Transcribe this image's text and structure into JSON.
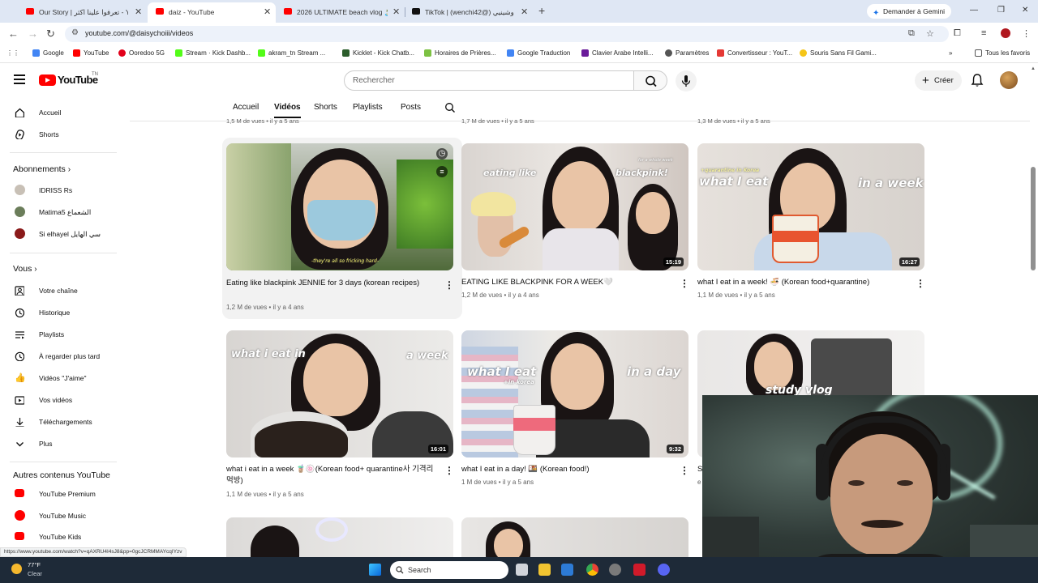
{
  "browser": {
    "tabs": [
      {
        "title": "Our Story | تعرفوا علينا اكثر - You",
        "active": false
      },
      {
        "title": "daiz - YouTube",
        "active": true
      },
      {
        "title": "2026 ULTIMATE beach vlog 🏝️ -",
        "active": false
      },
      {
        "title": "TikTok | (wenchi42@) وشينيي",
        "active": false
      }
    ],
    "gemini_button": "Demander à Gemini",
    "url": "youtube.com/@daisychoiii/videos",
    "bookmarks": [
      "Google",
      "YouTube",
      "Ooredoo 5G",
      "Stream · Kick Dashb...",
      "akram_tn Stream ...",
      "Kicklet - Kick Chatb...",
      "Horaires de Prières...",
      "Google Traduction",
      "Clavier Arabe Intelli...",
      "Paramètres",
      "Convertisseur : YouT...",
      "Souris Sans Fil Gami..."
    ],
    "all_favorites": "Tous les favoris",
    "colors": {
      "tabbar": "#dfe7f4",
      "youtube_red": "#ff0000"
    }
  },
  "masthead": {
    "logo_text": "YouTube",
    "country_code": "TN",
    "search_placeholder": "Rechercher",
    "create_label": "Créer"
  },
  "sidebar": {
    "top_items": [
      {
        "label": "Accueil",
        "icon": "home-icon"
      },
      {
        "label": "Shorts",
        "icon": "shorts-icon"
      }
    ],
    "subscriptions_title": "Abonnements",
    "subscriptions": [
      "IDRISS Rs",
      "Matima5 الشعماع",
      "Si elhayel سي الهايل"
    ],
    "you_title": "Vous",
    "you_items": [
      {
        "label": "Votre chaîne",
        "icon": "channel-icon"
      },
      {
        "label": "Historique",
        "icon": "history-icon"
      },
      {
        "label": "Playlists",
        "icon": "playlists-icon"
      },
      {
        "label": "À regarder plus tard",
        "icon": "watch-later-icon"
      },
      {
        "label": "Vidéos \"J'aime\"",
        "icon": "like-icon"
      },
      {
        "label": "Vos vidéos",
        "icon": "your-videos-icon"
      },
      {
        "label": "Téléchargements",
        "icon": "download-icon"
      },
      {
        "label": "Plus",
        "icon": "chevron-down-icon"
      }
    ],
    "more_title": "Autres contenus YouTube",
    "more_items": [
      "YouTube Premium",
      "YouTube Music",
      "YouTube Kids"
    ]
  },
  "channel_tabs": {
    "items": [
      "Accueil",
      "Vidéos",
      "Shorts",
      "Playlists",
      "Posts"
    ],
    "active": "Vidéos",
    "previous_row_meta": [
      "1,5 M de vues • il y a 5 ans",
      "1,7 M de vues • il y a 5 ans",
      "1,3 M de vues • il y a 5 ans"
    ]
  },
  "videos": [
    {
      "title": "Eating like blackpink JENNIE for 3 days (korean recipes)",
      "meta": "1,2 M de vues • il y a 4 ans",
      "duration": "",
      "caption": "-they're all so fricking hard-"
    },
    {
      "title": "EATING LIKE BLACKPINK FOR A WEEK🤍",
      "meta": "1,2 M de vues • il y a 4 ans",
      "duration": "15:19",
      "overlay": [
        "eating like",
        "blackpink!",
        "for a whole week"
      ]
    },
    {
      "title": "what I eat in a week! 🍜 (Korean food+quarantine)",
      "meta": "1,1 M de vues • il y a 5 ans",
      "duration": "16:27",
      "overlay": [
        "+quarantine in Korea",
        "what I eat",
        "in a week"
      ]
    },
    {
      "title": "what i eat in a week 🧋🍥(Korean food+ quarantine사 기격리 먹방)",
      "meta": "1,1 M de vues • il y a 5 ans",
      "duration": "16:01",
      "overlay": [
        "what i eat in",
        "a week"
      ]
    },
    {
      "title": "what I eat in a day! 🍱 (Korean food!)",
      "meta": "1 M de vues • il y a 5 ans",
      "duration": "9:32",
      "overlay": [
        "what I eat",
        "+in korea",
        "in a day"
      ]
    },
    {
      "title": "S",
      "meta": "e",
      "duration": "",
      "overlay": [
        "study vlog"
      ]
    }
  ],
  "status_url": "https://www.youtube.com/watch?v=qAXRU4I4sJ8&pp=0gcJCRMMAYcqIYzv",
  "taskbar": {
    "weather_temp": "77°F",
    "weather_desc": "Clear",
    "search_label": "Search"
  }
}
